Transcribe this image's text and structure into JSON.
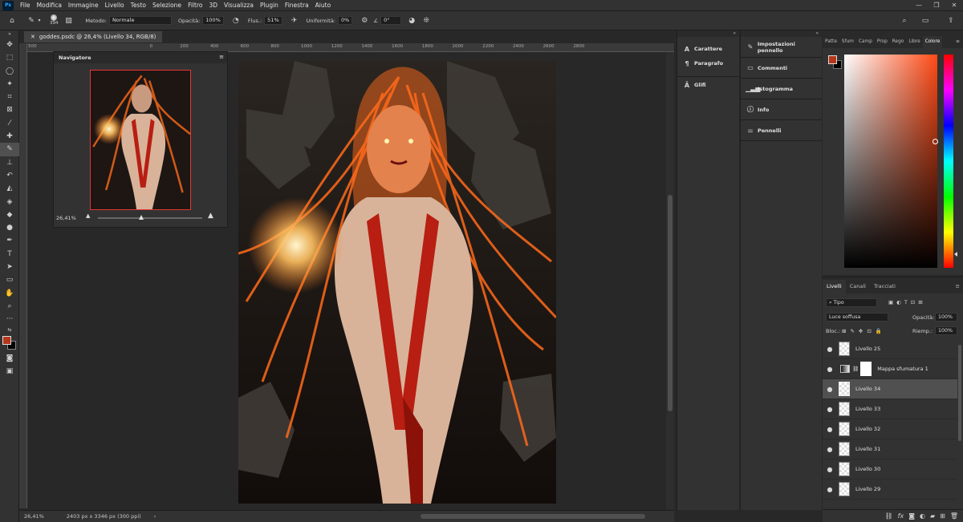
{
  "app": {
    "logo": "Ps"
  },
  "menu": [
    "File",
    "Modifica",
    "Immagine",
    "Livello",
    "Testo",
    "Selezione",
    "Filtro",
    "3D",
    "Visualizza",
    "Plugin",
    "Finestra",
    "Aiuto"
  ],
  "window_controls": [
    "—",
    "❐",
    "✕"
  ],
  "options": {
    "brush_size": "394",
    "mode_label": "Metodo:",
    "mode_value": "Normale",
    "opacity_label": "Opacità:",
    "opacity_value": "100%",
    "flow_label": "Flus.:",
    "flow_value": "51%",
    "smoothing_label": "Uniformità:",
    "smoothing_value": "0%",
    "angle_value": "0°"
  },
  "document": {
    "tab_title": "goddes.psdc @ 26,4% (Livello 34, RGB/8)",
    "zoom": "26,41%",
    "dimensions": "2403 px x 3346 px (300 ppi)"
  },
  "ruler_marks": [
    "500",
    "0",
    "200",
    "400",
    "600",
    "800",
    "1000",
    "1200",
    "1400",
    "1600",
    "1800",
    "2000",
    "2200",
    "2400",
    "2600",
    "2800"
  ],
  "navigator": {
    "title": "Navigatore",
    "zoom": "26,41%"
  },
  "dock_left": [
    {
      "icon": "type-icon",
      "label": "Carattere"
    },
    {
      "icon": "paragraph-icon",
      "label": "Paragrafo"
    },
    {
      "icon": "glyphs-icon",
      "label": "Glifi"
    }
  ],
  "dock_right": [
    {
      "icon": "brush-settings-icon",
      "label": "Impostazioni pennello"
    },
    {
      "icon": "comments-icon",
      "label": "Commenti"
    },
    {
      "icon": "histogram-icon",
      "label": "Istogramma"
    },
    {
      "icon": "info-icon",
      "label": "Info"
    },
    {
      "icon": "brushes-icon",
      "label": "Pennelli"
    }
  ],
  "color_panel": {
    "tabs": [
      "Patte",
      "Sfum",
      "Camp",
      "Prop",
      "Rego",
      "Libre",
      "Colore"
    ],
    "active_tab": "Colore",
    "foreground": "#b5361a",
    "background": "#000000"
  },
  "layers_panel": {
    "tabs": [
      "Livelli",
      "Canali",
      "Tracciati"
    ],
    "filter": "Tipo",
    "blend_mode": "Luce soffusa",
    "opacity_label": "Opacità:",
    "opacity": "100%",
    "lock_label": "Bloc.:",
    "fill_label": "Riemp.:",
    "fill": "100%",
    "layers": [
      {
        "name": "Livello 25",
        "selected": false
      },
      {
        "name": "Mappa sfumatura 1",
        "selected": false,
        "adjustment": true
      },
      {
        "name": "Livello 34",
        "selected": true
      },
      {
        "name": "Livello 33",
        "selected": false
      },
      {
        "name": "Livello 32",
        "selected": false
      },
      {
        "name": "Livello 31",
        "selected": false
      },
      {
        "name": "Livello 30",
        "selected": false
      },
      {
        "name": "Livello 29",
        "selected": false
      }
    ]
  }
}
